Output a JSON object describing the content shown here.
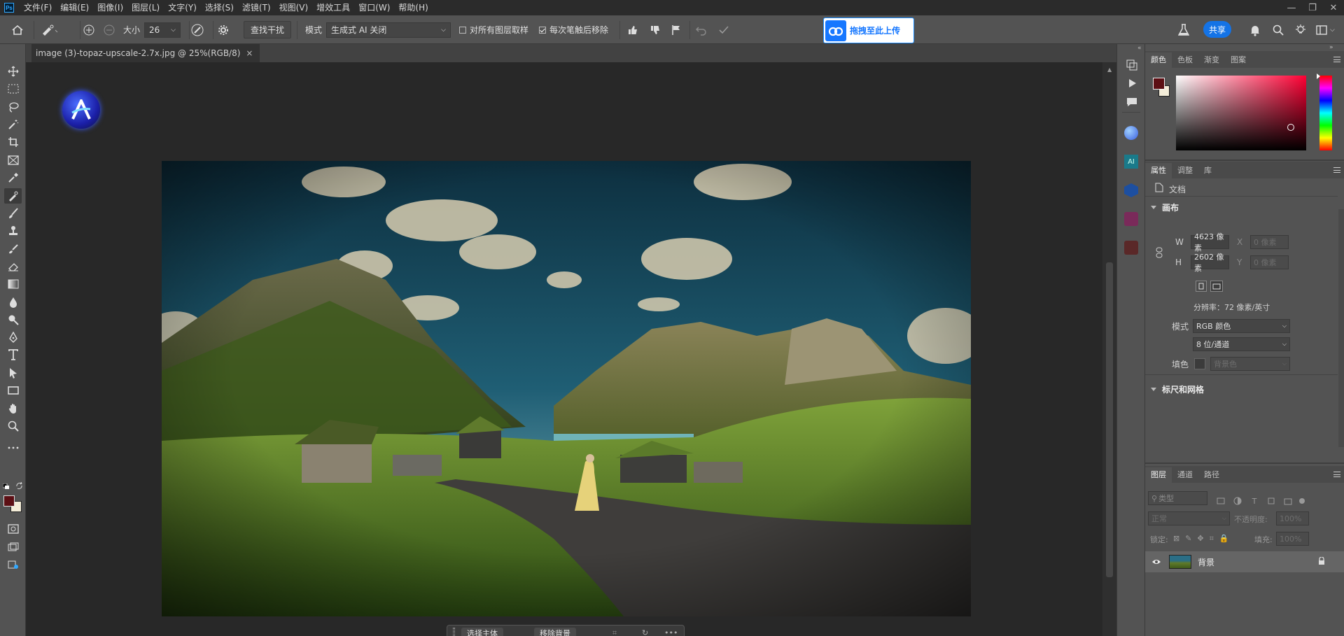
{
  "menu": {
    "logo": "Ps",
    "items": [
      "文件(F)",
      "编辑(E)",
      "图像(I)",
      "图层(L)",
      "文字(Y)",
      "选择(S)",
      "滤镜(T)",
      "视图(V)",
      "增效工具",
      "窗口(W)",
      "帮助(H)"
    ]
  },
  "options": {
    "size_label": "大小",
    "size_value": "26",
    "find_distractions": "查找干扰",
    "mode_label": "模式",
    "mode_value": "生成式 AI 关闭",
    "sample_all_layers": "对所有图层取样",
    "remove_after_stroke": "每次笔触后移除",
    "upload_label": "拖拽至此上传",
    "share_label": "共享"
  },
  "document": {
    "tab_title": "image (3)-topaz-upscale-2.7x.jpg @ 25%(RGB/8)",
    "close_glyph": "×"
  },
  "taskbar": {
    "select_subject": "选择主体",
    "remove_background": "移除背景"
  },
  "colors": {
    "foreground": "#5c0f14",
    "background": "#f3ecd8",
    "accent": "#1473e6",
    "upload_brand": "#1677ff"
  },
  "color_panel": {
    "tabs": [
      "颜色",
      "色板",
      "渐变",
      "图案"
    ]
  },
  "properties_panel": {
    "tabs": [
      "属性",
      "调整",
      "库"
    ],
    "doc_label": "文档",
    "canvas_title": "画布",
    "w_label": "W",
    "w_value": "4623 像素",
    "h_label": "H",
    "h_value": "2602 像素",
    "x_label": "X",
    "x_placeholder": "0 像素",
    "y_label": "Y",
    "y_placeholder": "0 像素",
    "resolution": "分辨率：72 像素/英寸",
    "mode_label": "模式",
    "mode_value": "RGB 颜色",
    "depth_value": "8 位/通道",
    "fill_label": "填色",
    "fill_value": "背景色",
    "rulers_title": "标尺和网格"
  },
  "layers_panel": {
    "tabs": [
      "图层",
      "通道",
      "路径"
    ],
    "filter_placeholder": "类型",
    "blend_mode": "正常",
    "opacity_label": "不透明度:",
    "opacity_value": "100%",
    "lock_label": "锁定:",
    "fill_label": "填充:",
    "fill_value": "100%",
    "layers": [
      {
        "name": "背景",
        "visible": true,
        "locked": true
      }
    ]
  }
}
